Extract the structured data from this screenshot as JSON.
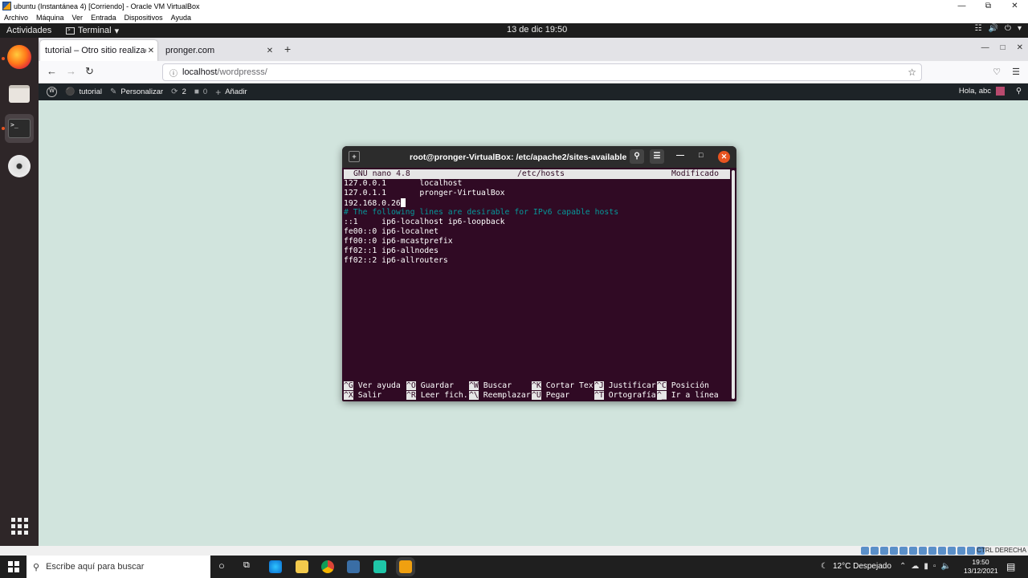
{
  "vbox": {
    "title": "ubuntu (Instantánea 4) [Corriendo] - Oracle VM VirtualBox",
    "menu": [
      "Archivo",
      "Máquina",
      "Ver",
      "Entrada",
      "Dispositivos",
      "Ayuda"
    ],
    "status_host_key": "CTRL DERECHA"
  },
  "gnome": {
    "activities": "Actividades",
    "app_name": "Terminal",
    "clock": "13 de dic  19:50"
  },
  "firefox": {
    "tabs": [
      {
        "label": "tutorial – Otro sitio realizado con WordPress"
      },
      {
        "label": "pronger.com"
      }
    ],
    "url_host": "localhost",
    "url_path": "/wordpresss/"
  },
  "wp_bar": {
    "site": "tutorial",
    "customize": "Personalizar",
    "updates": "2",
    "comments": "0",
    "add": "Añadir",
    "greeting": "Hola, abc"
  },
  "terminal": {
    "title": "root@pronger-VirtualBox: /etc/apache2/sites-available",
    "nano_version": "GNU nano 4.8",
    "file": "/etc/hosts",
    "state": "Modificado",
    "lines": [
      "127.0.0.1       localhost",
      "127.0.1.1       pronger-VirtualBox",
      "192.168.0.26",
      "# The following lines are desirable for IPv6 capable hosts",
      "::1     ip6-localhost ip6-loopback",
      "fe00::0 ip6-localnet",
      "ff00::0 ip6-mcastprefix",
      "ff02::1 ip6-allnodes",
      "ff02::2 ip6-allrouters"
    ],
    "shortcuts_row1": [
      {
        "key": "^G",
        "label": "Ver ayuda"
      },
      {
        "key": "^O",
        "label": "Guardar"
      },
      {
        "key": "^W",
        "label": "Buscar"
      },
      {
        "key": "^K",
        "label": "Cortar Tex"
      },
      {
        "key": "^J",
        "label": "Justificar"
      },
      {
        "key": "^C",
        "label": "Posición"
      }
    ],
    "shortcuts_row2": [
      {
        "key": "^X",
        "label": "Salir"
      },
      {
        "key": "^R",
        "label": "Leer fich."
      },
      {
        "key": "^\\",
        "label": "Reemplazar"
      },
      {
        "key": "^U",
        "label": "Pegar"
      },
      {
        "key": "^T",
        "label": "Ortografía"
      },
      {
        "key": "^_",
        "label": "Ir a línea"
      }
    ]
  },
  "taskbar": {
    "search_placeholder": "Escribe aquí para buscar",
    "weather": "12°C  Despejado",
    "time": "19:50",
    "date": "13/12/2021"
  }
}
